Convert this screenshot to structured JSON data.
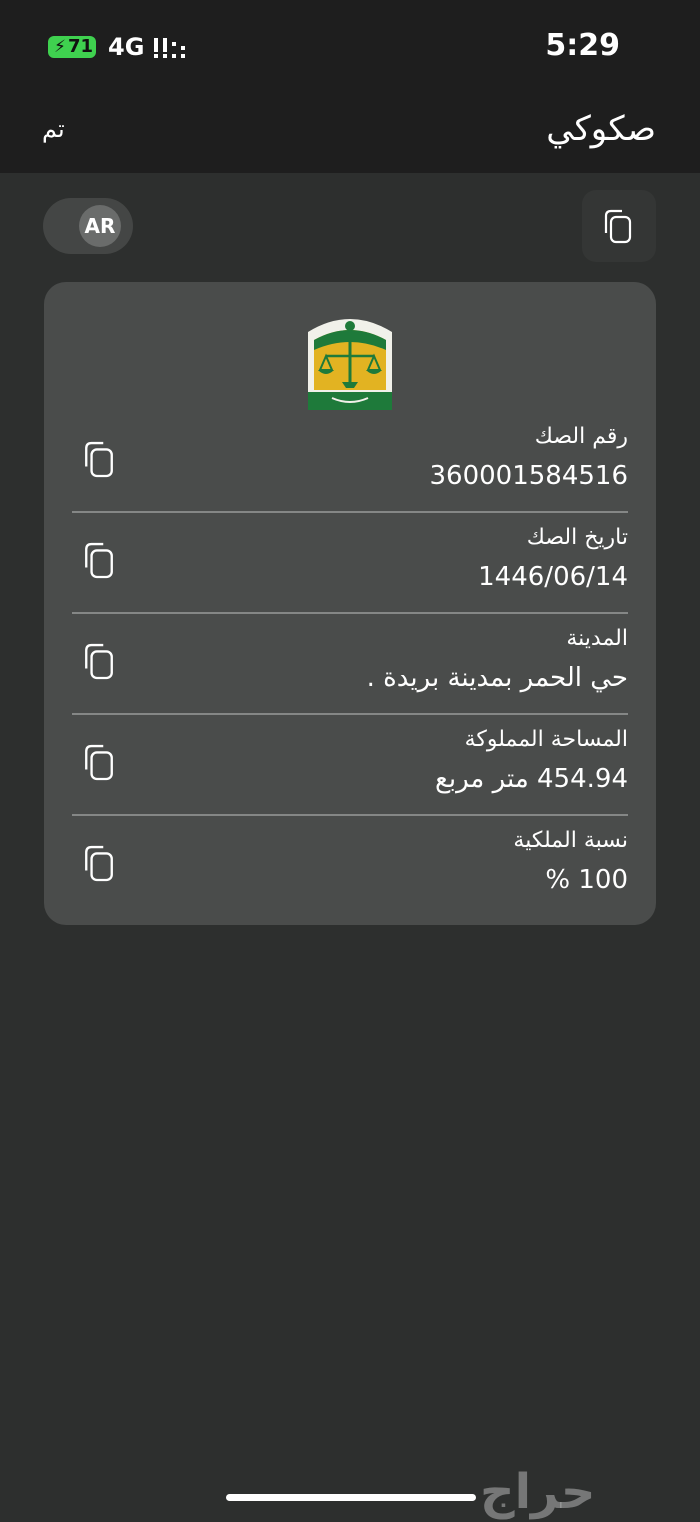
{
  "status_bar": {
    "battery": "71",
    "network": "4G",
    "time": "5:29"
  },
  "nav": {
    "title": "صكوكي",
    "done_label": "تم"
  },
  "language_toggle": "AR",
  "logo_icon": "ministry-of-justice-emblem",
  "deed": {
    "rows": [
      {
        "label": "رقم الصك",
        "value": "360001584516"
      },
      {
        "label": "تاريخ الصك",
        "value": "1446/06/14"
      },
      {
        "label": "المدينة",
        "value": "حي الحمر بمدينة بريدة ."
      },
      {
        "label": "المساحة المملوكة",
        "value": "454.94 متر مربع"
      },
      {
        "label": "نسبة الملكية",
        "value": "100 %"
      }
    ]
  },
  "watermark": "حراج",
  "colors": {
    "background": "#2d2f2e",
    "card": "#4a4c4b",
    "battery": "#3fd14f",
    "logo_gold": "#e2b322",
    "logo_green": "#1e7a3a"
  }
}
